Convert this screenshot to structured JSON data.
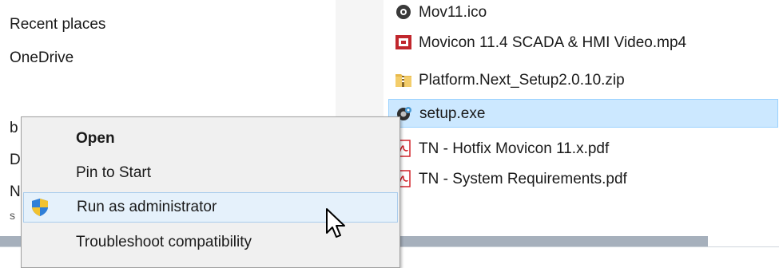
{
  "nav": {
    "items": [
      "Recent places",
      "OneDrive"
    ],
    "fragments": [
      "b",
      "D",
      "N",
      "s"
    ]
  },
  "files": [
    {
      "name": "Mov11.ico",
      "icon": "movicon-icon"
    },
    {
      "name": "Movicon 11.4 SCADA & HMI Video.mp4",
      "icon": "video-file-icon"
    },
    {
      "name": "Platform.Next_Setup2.0.10.zip",
      "icon": "zip-folder-icon"
    },
    {
      "name": "setup.exe",
      "icon": "setup-exe-icon",
      "selected": true
    },
    {
      "name": "TN - Hotfix Movicon 11.x.pdf",
      "icon": "pdf-file-icon"
    },
    {
      "name": "TN - System Requirements.pdf",
      "icon": "pdf-file-icon"
    }
  ],
  "context_menu": {
    "items": [
      {
        "label": "Open",
        "bold": true
      },
      {
        "label": "Pin to Start"
      },
      {
        "label": "Run as administrator",
        "highlighted": true,
        "icon": "uac-shield-icon"
      },
      {
        "label": "Troubleshoot compatibility"
      }
    ]
  },
  "colors": {
    "selection": "#cce8ff",
    "menu_highlight": "#e5f1fb",
    "menu_background": "#f0f0f0",
    "pdf_red": "#d2232a"
  }
}
